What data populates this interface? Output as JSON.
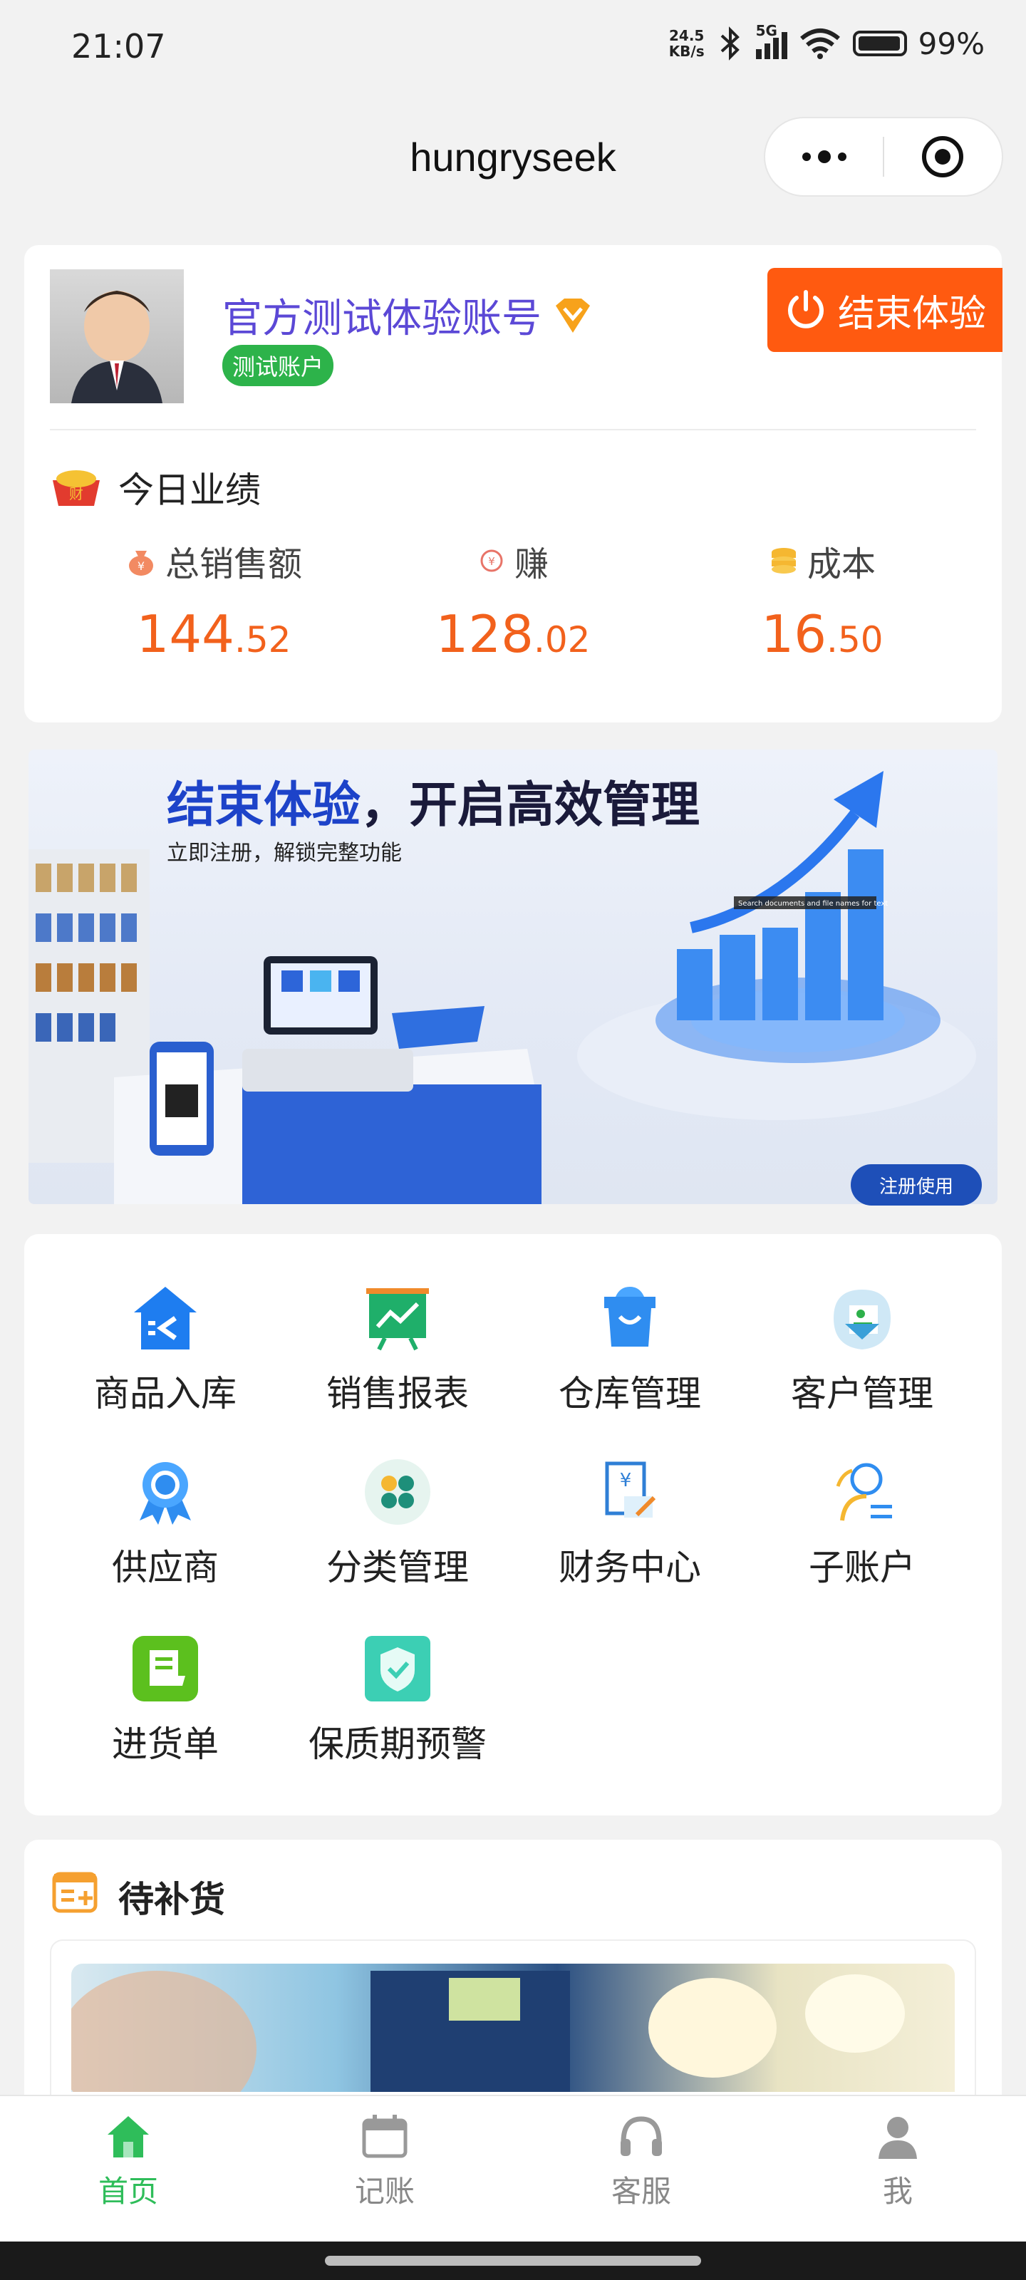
{
  "status": {
    "time": "21:07",
    "net_speed": "24.5",
    "net_unit": "KB/s",
    "network": "5G",
    "battery": "99%"
  },
  "header": {
    "title": "hungryseek"
  },
  "account": {
    "name": "官方测试体验账号",
    "badge": "测试账户",
    "end_button": "结束体验"
  },
  "today": {
    "title": "今日业绩",
    "stats": [
      {
        "label": "总销售额",
        "int": "144",
        "dec": ".52"
      },
      {
        "label": "赚",
        "int": "128",
        "dec": ".02"
      },
      {
        "label": "成本",
        "int": "16",
        "dec": ".50"
      }
    ]
  },
  "banner": {
    "headline_a": "结束体验",
    "headline_b": "，开启高效管理",
    "subline": "立即注册，解锁完整功能",
    "tooltip": "Search documents and file names for text",
    "button": "注册使用"
  },
  "menu": [
    {
      "label": "商品入库",
      "icon": "warehouse-in-icon",
      "color": "#1e7df0"
    },
    {
      "label": "销售报表",
      "icon": "sales-chart-icon",
      "color": "#1faf6a"
    },
    {
      "label": "仓库管理",
      "icon": "basket-icon",
      "color": "#2f8df0"
    },
    {
      "label": "客户管理",
      "icon": "customer-card-icon",
      "color": "#3aa0d8"
    },
    {
      "label": "供应商",
      "icon": "award-ribbon-icon",
      "color": "#2f8df0"
    },
    {
      "label": "分类管理",
      "icon": "category-grid-icon",
      "color": "#1e8f7a"
    },
    {
      "label": "财务中心",
      "icon": "finance-receipt-icon",
      "color": "#2f7fd6"
    },
    {
      "label": "子账户",
      "icon": "sub-account-icon",
      "color": "#2f8df0"
    },
    {
      "label": "进货单",
      "icon": "purchase-order-icon",
      "color": "#5cc01e"
    },
    {
      "label": "保质期预警",
      "icon": "shield-check-icon",
      "color": "#3ccfb4"
    }
  ],
  "restock": {
    "title": "待补货"
  },
  "tabbar": [
    {
      "label": "首页",
      "icon": "home-icon",
      "active": true
    },
    {
      "label": "记账",
      "icon": "calendar-icon",
      "active": false
    },
    {
      "label": "客服",
      "icon": "headset-icon",
      "active": false
    },
    {
      "label": "我",
      "icon": "user-icon",
      "active": false
    }
  ]
}
